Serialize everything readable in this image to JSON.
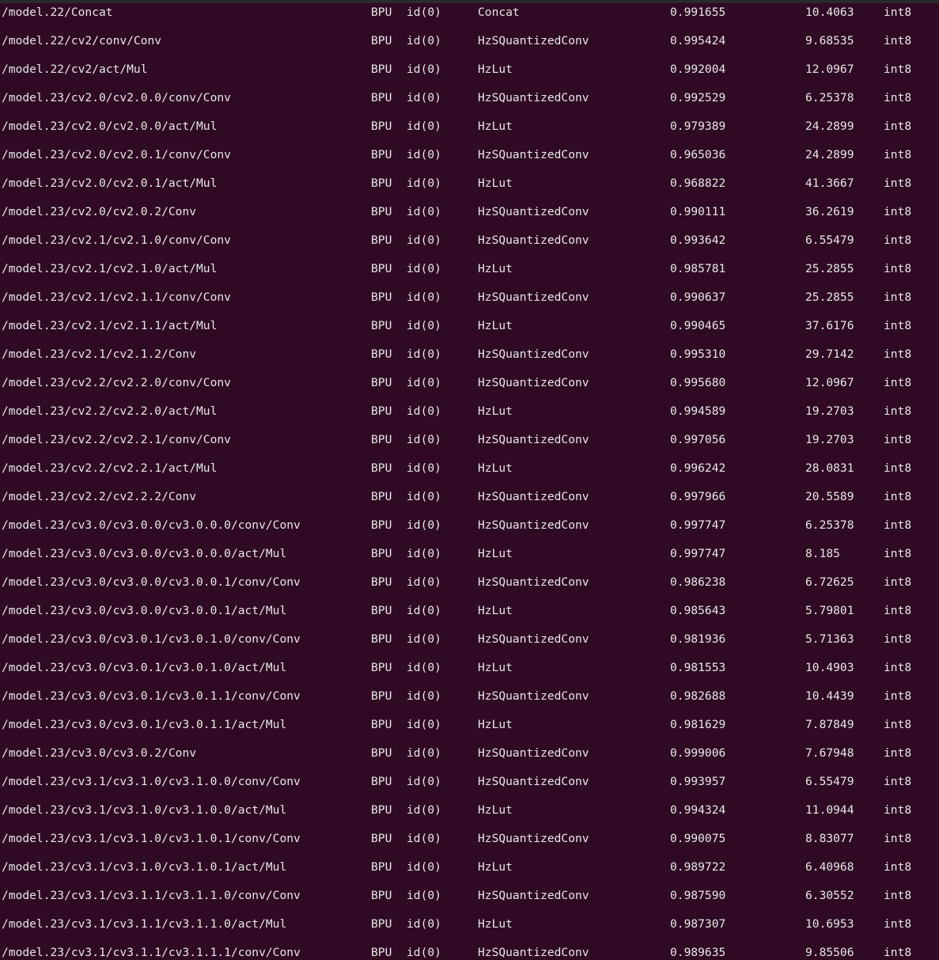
{
  "terminal": {
    "rows": [
      {
        "name": "/model.22/Concat",
        "device": "BPU",
        "id": "id(0)",
        "op": "Concat",
        "similarity": "0.991655",
        "max": "10.4063",
        "dtype": "int8"
      },
      {
        "name": "/model.22/cv2/conv/Conv",
        "device": "BPU",
        "id": "id(0)",
        "op": "HzSQuantizedConv",
        "similarity": "0.995424",
        "max": "9.68535",
        "dtype": "int8"
      },
      {
        "name": "/model.22/cv2/act/Mul",
        "device": "BPU",
        "id": "id(0)",
        "op": "HzLut",
        "similarity": "0.992004",
        "max": "12.0967",
        "dtype": "int8"
      },
      {
        "name": "/model.23/cv2.0/cv2.0.0/conv/Conv",
        "device": "BPU",
        "id": "id(0)",
        "op": "HzSQuantizedConv",
        "similarity": "0.992529",
        "max": "6.25378",
        "dtype": "int8"
      },
      {
        "name": "/model.23/cv2.0/cv2.0.0/act/Mul",
        "device": "BPU",
        "id": "id(0)",
        "op": "HzLut",
        "similarity": "0.979389",
        "max": "24.2899",
        "dtype": "int8"
      },
      {
        "name": "/model.23/cv2.0/cv2.0.1/conv/Conv",
        "device": "BPU",
        "id": "id(0)",
        "op": "HzSQuantizedConv",
        "similarity": "0.965036",
        "max": "24.2899",
        "dtype": "int8"
      },
      {
        "name": "/model.23/cv2.0/cv2.0.1/act/Mul",
        "device": "BPU",
        "id": "id(0)",
        "op": "HzLut",
        "similarity": "0.968822",
        "max": "41.3667",
        "dtype": "int8"
      },
      {
        "name": "/model.23/cv2.0/cv2.0.2/Conv",
        "device": "BPU",
        "id": "id(0)",
        "op": "HzSQuantizedConv",
        "similarity": "0.990111",
        "max": "36.2619",
        "dtype": "int8"
      },
      {
        "name": "/model.23/cv2.1/cv2.1.0/conv/Conv",
        "device": "BPU",
        "id": "id(0)",
        "op": "HzSQuantizedConv",
        "similarity": "0.993642",
        "max": "6.55479",
        "dtype": "int8"
      },
      {
        "name": "/model.23/cv2.1/cv2.1.0/act/Mul",
        "device": "BPU",
        "id": "id(0)",
        "op": "HzLut",
        "similarity": "0.985781",
        "max": "25.2855",
        "dtype": "int8"
      },
      {
        "name": "/model.23/cv2.1/cv2.1.1/conv/Conv",
        "device": "BPU",
        "id": "id(0)",
        "op": "HzSQuantizedConv",
        "similarity": "0.990637",
        "max": "25.2855",
        "dtype": "int8"
      },
      {
        "name": "/model.23/cv2.1/cv2.1.1/act/Mul",
        "device": "BPU",
        "id": "id(0)",
        "op": "HzLut",
        "similarity": "0.990465",
        "max": "37.6176",
        "dtype": "int8"
      },
      {
        "name": "/model.23/cv2.1/cv2.1.2/Conv",
        "device": "BPU",
        "id": "id(0)",
        "op": "HzSQuantizedConv",
        "similarity": "0.995310",
        "max": "29.7142",
        "dtype": "int8"
      },
      {
        "name": "/model.23/cv2.2/cv2.2.0/conv/Conv",
        "device": "BPU",
        "id": "id(0)",
        "op": "HzSQuantizedConv",
        "similarity": "0.995680",
        "max": "12.0967",
        "dtype": "int8"
      },
      {
        "name": "/model.23/cv2.2/cv2.2.0/act/Mul",
        "device": "BPU",
        "id": "id(0)",
        "op": "HzLut",
        "similarity": "0.994589",
        "max": "19.2703",
        "dtype": "int8"
      },
      {
        "name": "/model.23/cv2.2/cv2.2.1/conv/Conv",
        "device": "BPU",
        "id": "id(0)",
        "op": "HzSQuantizedConv",
        "similarity": "0.997056",
        "max": "19.2703",
        "dtype": "int8"
      },
      {
        "name": "/model.23/cv2.2/cv2.2.1/act/Mul",
        "device": "BPU",
        "id": "id(0)",
        "op": "HzLut",
        "similarity": "0.996242",
        "max": "28.0831",
        "dtype": "int8"
      },
      {
        "name": "/model.23/cv2.2/cv2.2.2/Conv",
        "device": "BPU",
        "id": "id(0)",
        "op": "HzSQuantizedConv",
        "similarity": "0.997966",
        "max": "20.5589",
        "dtype": "int8"
      },
      {
        "name": "/model.23/cv3.0/cv3.0.0/cv3.0.0.0/conv/Conv",
        "device": "BPU",
        "id": "id(0)",
        "op": "HzSQuantizedConv",
        "similarity": "0.997747",
        "max": "6.25378",
        "dtype": "int8"
      },
      {
        "name": "/model.23/cv3.0/cv3.0.0/cv3.0.0.0/act/Mul",
        "device": "BPU",
        "id": "id(0)",
        "op": "HzLut",
        "similarity": "0.997747",
        "max": "8.185",
        "dtype": "int8"
      },
      {
        "name": "/model.23/cv3.0/cv3.0.0/cv3.0.0.1/conv/Conv",
        "device": "BPU",
        "id": "id(0)",
        "op": "HzSQuantizedConv",
        "similarity": "0.986238",
        "max": "6.72625",
        "dtype": "int8"
      },
      {
        "name": "/model.23/cv3.0/cv3.0.0/cv3.0.0.1/act/Mul",
        "device": "BPU",
        "id": "id(0)",
        "op": "HzLut",
        "similarity": "0.985643",
        "max": "5.79801",
        "dtype": "int8"
      },
      {
        "name": "/model.23/cv3.0/cv3.0.1/cv3.0.1.0/conv/Conv",
        "device": "BPU",
        "id": "id(0)",
        "op": "HzSQuantizedConv",
        "similarity": "0.981936",
        "max": "5.71363",
        "dtype": "int8"
      },
      {
        "name": "/model.23/cv3.0/cv3.0.1/cv3.0.1.0/act/Mul",
        "device": "BPU",
        "id": "id(0)",
        "op": "HzLut",
        "similarity": "0.981553",
        "max": "10.4903",
        "dtype": "int8"
      },
      {
        "name": "/model.23/cv3.0/cv3.0.1/cv3.0.1.1/conv/Conv",
        "device": "BPU",
        "id": "id(0)",
        "op": "HzSQuantizedConv",
        "similarity": "0.982688",
        "max": "10.4439",
        "dtype": "int8"
      },
      {
        "name": "/model.23/cv3.0/cv3.0.1/cv3.0.1.1/act/Mul",
        "device": "BPU",
        "id": "id(0)",
        "op": "HzLut",
        "similarity": "0.981629",
        "max": "7.87849",
        "dtype": "int8"
      },
      {
        "name": "/model.23/cv3.0/cv3.0.2/Conv",
        "device": "BPU",
        "id": "id(0)",
        "op": "HzSQuantizedConv",
        "similarity": "0.999006",
        "max": "7.67948",
        "dtype": "int8"
      },
      {
        "name": "/model.23/cv3.1/cv3.1.0/cv3.1.0.0/conv/Conv",
        "device": "BPU",
        "id": "id(0)",
        "op": "HzSQuantizedConv",
        "similarity": "0.993957",
        "max": "6.55479",
        "dtype": "int8"
      },
      {
        "name": "/model.23/cv3.1/cv3.1.0/cv3.1.0.0/act/Mul",
        "device": "BPU",
        "id": "id(0)",
        "op": "HzLut",
        "similarity": "0.994324",
        "max": "11.0944",
        "dtype": "int8"
      },
      {
        "name": "/model.23/cv3.1/cv3.1.0/cv3.1.0.1/conv/Conv",
        "device": "BPU",
        "id": "id(0)",
        "op": "HzSQuantizedConv",
        "similarity": "0.990075",
        "max": "8.83077",
        "dtype": "int8"
      },
      {
        "name": "/model.23/cv3.1/cv3.1.0/cv3.1.0.1/act/Mul",
        "device": "BPU",
        "id": "id(0)",
        "op": "HzLut",
        "similarity": "0.989722",
        "max": "6.40968",
        "dtype": "int8"
      },
      {
        "name": "/model.23/cv3.1/cv3.1.1/cv3.1.1.0/conv/Conv",
        "device": "BPU",
        "id": "id(0)",
        "op": "HzSQuantizedConv",
        "similarity": "0.987590",
        "max": "6.30552",
        "dtype": "int8"
      },
      {
        "name": "/model.23/cv3.1/cv3.1.1/cv3.1.1.0/act/Mul",
        "device": "BPU",
        "id": "id(0)",
        "op": "HzLut",
        "similarity": "0.987307",
        "max": "10.6953",
        "dtype": "int8"
      },
      {
        "name": "/model.23/cv3.1/cv3.1.1/cv3.1.1.1/conv/Conv",
        "device": "BPU",
        "id": "id(0)",
        "op": "HzSQuantizedConv",
        "similarity": "0.989635",
        "max": "9.85506",
        "dtype": "int8"
      }
    ]
  }
}
